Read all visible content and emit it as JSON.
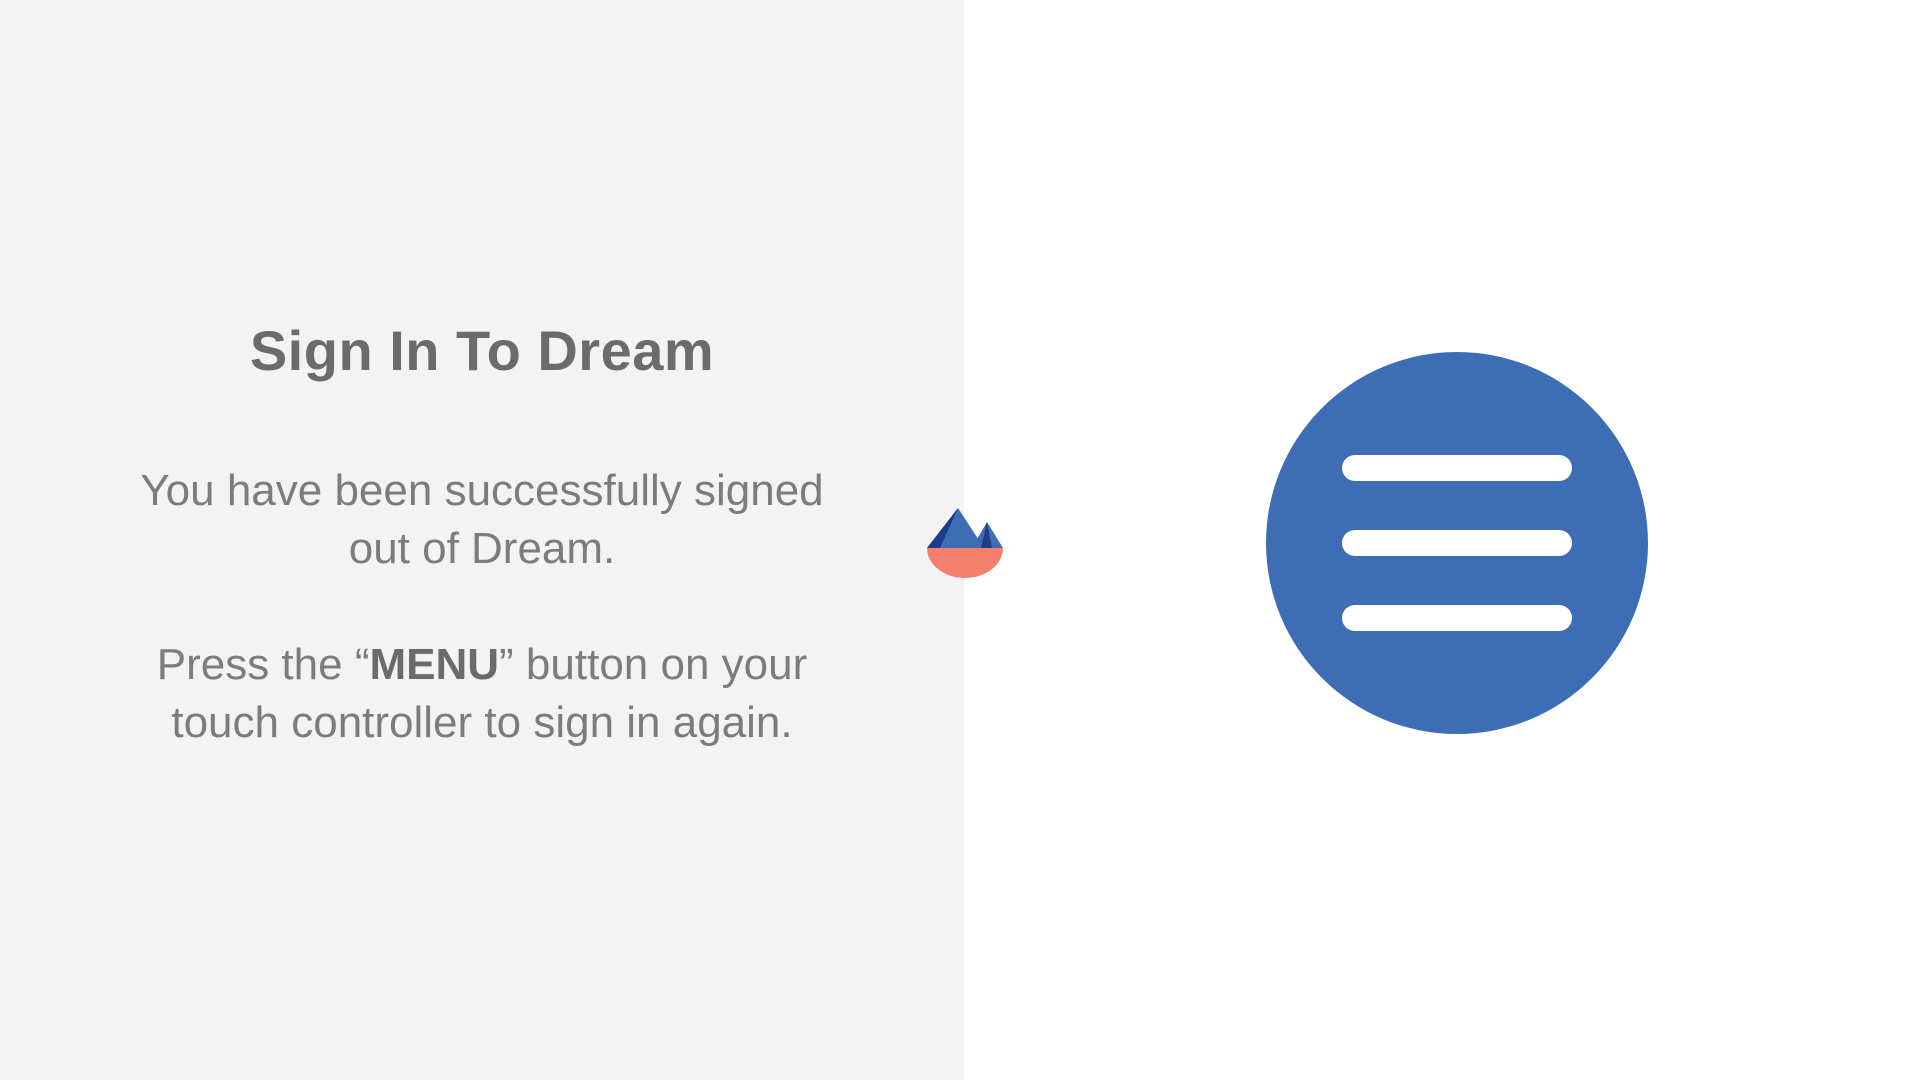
{
  "left_panel": {
    "title": "Sign In To Dream",
    "signed_out_message": {
      "line1": "You have been successfully signed",
      "line2": "out of Dream."
    },
    "instruction": {
      "prefix": "Press the “",
      "button_name": "MENU",
      "suffix": "” button on your",
      "line2": "touch controller to sign in again."
    }
  },
  "logo": {
    "icon": "dream-mountain-logo-icon"
  },
  "right_panel": {
    "icon": "menu-icon"
  },
  "colors": {
    "left_background": "#f3f3f3",
    "right_background": "#ffffff",
    "title_text": "#6b6b6b",
    "body_text": "#7c7c7c",
    "menu_circle": "#3d6db5",
    "logo_blue": "#3d6db5",
    "logo_dark_blue": "#1f3d87",
    "logo_coral": "#f47f6b"
  }
}
